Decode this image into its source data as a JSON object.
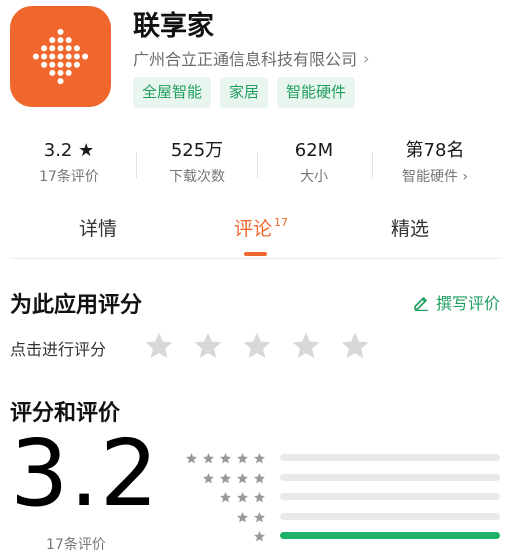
{
  "app": {
    "name": "联享家",
    "developer": "广州合立正通信息科技有限公司",
    "tags": [
      "全屋智能",
      "家居",
      "智能硬件"
    ],
    "brand_color": "#f0672e"
  },
  "stats": [
    {
      "value": "3.2 ★",
      "label": "17条评价"
    },
    {
      "value": "525万",
      "label": "下载次数"
    },
    {
      "value": "62M",
      "label": "大小"
    },
    {
      "value": "第78名",
      "label": "智能硬件 ›"
    }
  ],
  "tabs": [
    {
      "label": "详情",
      "badge": ""
    },
    {
      "label": "评论",
      "badge": "17"
    },
    {
      "label": "精选",
      "badge": ""
    }
  ],
  "rate_section": {
    "title": "为此应用评分",
    "write_review": "撰写评价",
    "tap_to_rate": "点击进行评分"
  },
  "score_section": {
    "title": "评分和评价",
    "score": "3.2",
    "review_count": "17条评价",
    "distribution": [
      {
        "stars": 5,
        "fraction": 0.0
      },
      {
        "stars": 4,
        "fraction": 0.0
      },
      {
        "stars": 3,
        "fraction": 0.0
      },
      {
        "stars": 2,
        "fraction": 0.0
      },
      {
        "stars": 1,
        "fraction": 1.0
      }
    ]
  },
  "colors": {
    "accent": "#f0672e",
    "green": "#1f9d5f",
    "bar_green": "#1fb26a",
    "star_gray": "#d8d8d8"
  }
}
